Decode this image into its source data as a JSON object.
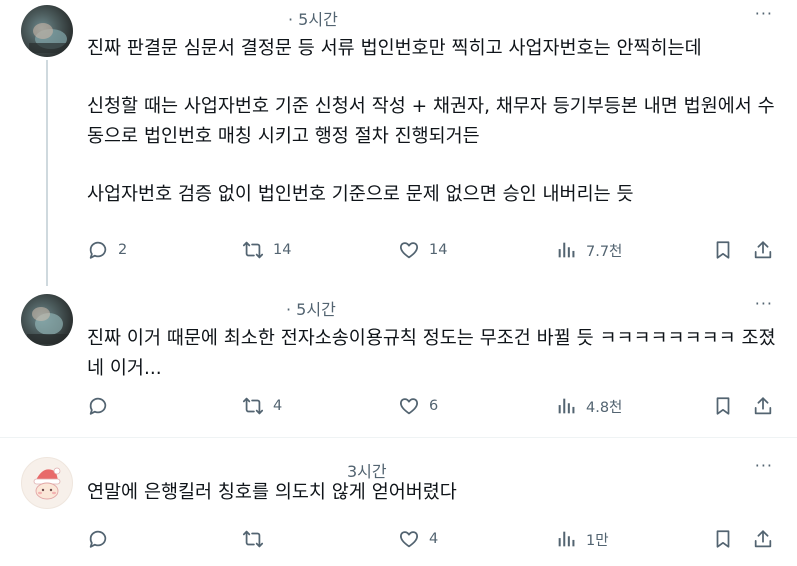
{
  "posts": [
    {
      "time": "· 5시간",
      "more": "···",
      "paragraphs": [
        "진짜 판결문 심문서 결정문 등 서류 법인번호만 찍히고 사업자번호는 안찍히는데",
        "신청할 때는 사업자번호 기준 신청서 작성 + 채권자, 채무자 등기부등본 내면 법원에서 수동으로 법인번호 매칭 시키고 행정 절차 진행되거든",
        "사업자번호 검증 없이 법인번호 기준으로 문제 없으면 승인 내버리는 듯"
      ],
      "stats": {
        "replies": "2",
        "reposts": "14",
        "likes": "14",
        "views": "7.7천"
      }
    },
    {
      "time": "· 5시간",
      "more": "···",
      "paragraphs": [
        "진짜 이거 때문에 최소한 전자소송이용규칙 정도는 무조건 바뀔 듯 ㅋㅋㅋㅋㅋㅋㅋㅋ 조졌네 이거..."
      ],
      "stats": {
        "replies": "",
        "reposts": "4",
        "likes": "6",
        "views": "4.8천"
      }
    },
    {
      "time": "3시간",
      "more": "···",
      "paragraphs": [
        "연말에 은행킬러 칭호를 의도치 않게 얻어버렸다"
      ],
      "stats": {
        "replies": "",
        "reposts": "",
        "likes": "4",
        "views": "1만"
      }
    }
  ],
  "icons": [
    "reply-icon",
    "repost-icon",
    "like-icon",
    "views-icon",
    "bookmark-icon",
    "share-icon",
    "more-icon"
  ],
  "colors": {
    "text": "#0f1419",
    "secondary": "#536471",
    "divider": "#eff3f4",
    "thread": "#cfd9de"
  }
}
